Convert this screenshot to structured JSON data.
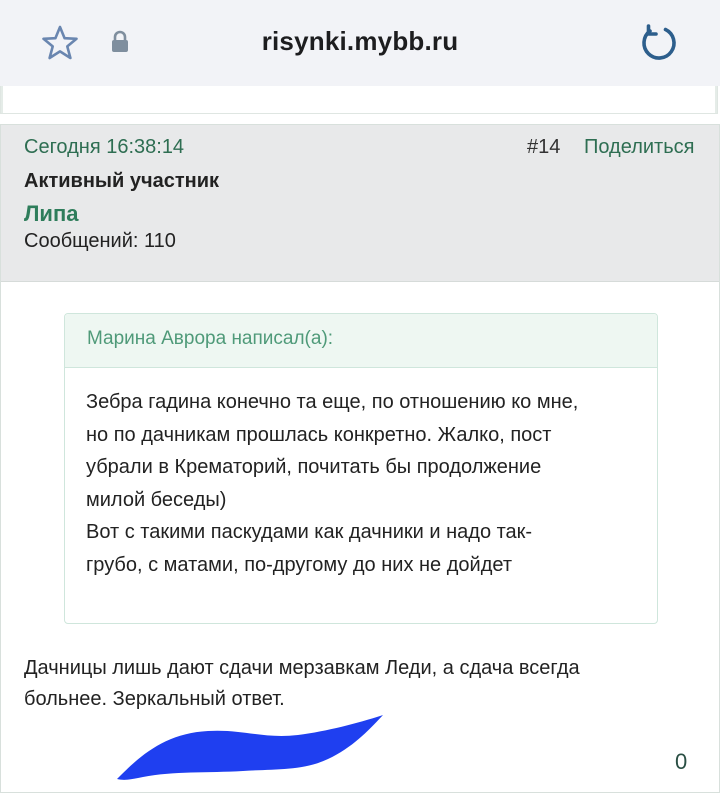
{
  "browser": {
    "url": "risynki.mybb.ru"
  },
  "post": {
    "timestamp": "Сегодня 16:38:14",
    "number": "#14",
    "share_label": "Поделиться",
    "user_title": "Активный участник",
    "username": "Липа",
    "messages_count": "Сообщений: 110",
    "quote": {
      "author": "Марина Аврора написал(а):",
      "lines": [
        "Зебра гадина конечно та еще, по отношению ко мне,",
        "но по дачникам прошлась конкретно. Жалко, пост",
        "убрали в Крематорий, почитать бы продолжение",
        "милой беседы)",
        "Вот с такими паскудами как дачники и надо так-",
        "грубо, с матами, по-другому до них не дойдет"
      ]
    },
    "text_lines": [
      "Дачницы лишь дают сдачи мерзавкам Леди, а сдача всегда",
      "больнее. Зеркальный ответ."
    ],
    "rating": "0"
  },
  "colors": {
    "accent_green": "#2e7d5b",
    "header_bg": "#e8e9ea",
    "quote_header_bg": "#eef7f2",
    "scribble_blue": "#1f3ff0"
  }
}
